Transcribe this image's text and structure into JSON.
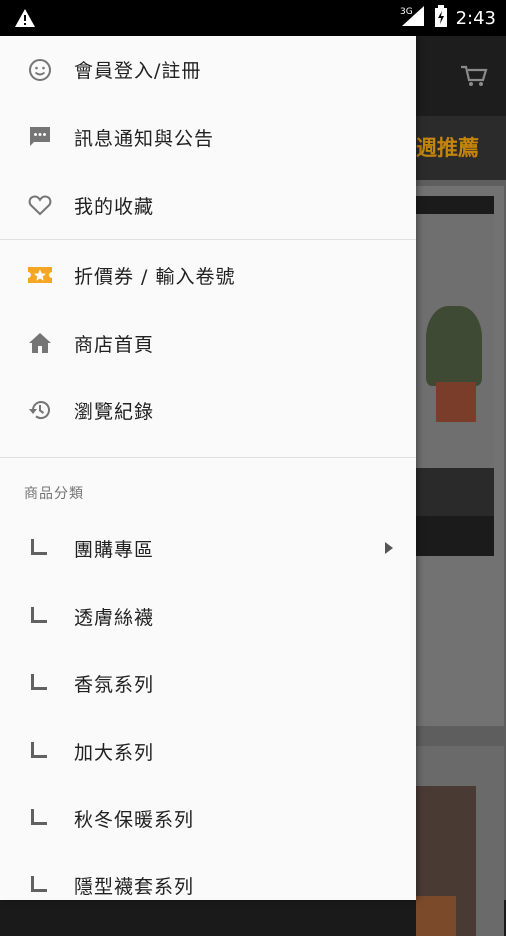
{
  "status_bar": {
    "time": "2:43",
    "network": "3G",
    "icons": [
      "warning-icon",
      "signal-icon",
      "battery-icon"
    ]
  },
  "background_app": {
    "tab_partial_label": "週推薦",
    "icons": [
      "cart-icon"
    ]
  },
  "drawer": {
    "account_items": [
      {
        "label": "會員登入/註冊",
        "icon": "smiley-icon"
      },
      {
        "label": "訊息通知與公告",
        "icon": "message-icon"
      },
      {
        "label": "我的收藏",
        "icon": "heart-icon"
      }
    ],
    "shop_items": [
      {
        "label": "折價券 / 輸入卷號",
        "icon": "coupon-icon"
      },
      {
        "label": "商店首頁",
        "icon": "home-icon"
      },
      {
        "label": "瀏覽紀錄",
        "icon": "history-icon"
      }
    ],
    "categories_header": "商品分類",
    "categories": [
      {
        "label": "團購專區",
        "has_submenu": true
      },
      {
        "label": "透膚絲襪"
      },
      {
        "label": "香氛系列"
      },
      {
        "label": "加大系列"
      },
      {
        "label": "秋冬保暖系列"
      },
      {
        "label": "隱型襪套系列"
      }
    ]
  },
  "colors": {
    "accent": "#f5a623",
    "icon_gray": "#757575",
    "drawer_bg": "#fafafa",
    "tab_text": "#c4850a"
  }
}
